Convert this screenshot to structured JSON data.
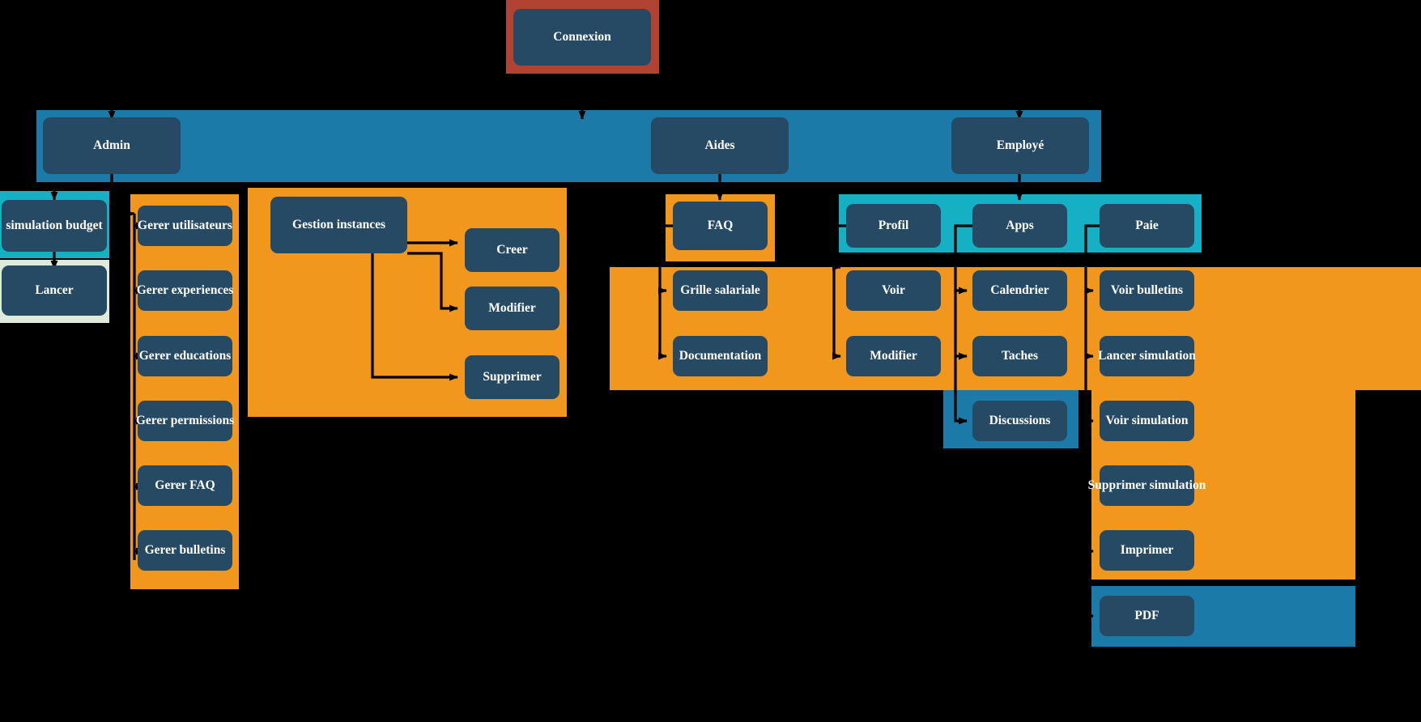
{
  "diagram": {
    "title": "Connexion",
    "type": "hierarchy-flowchart",
    "colors": {
      "node_fill": "#264a63",
      "node_text": "#ffffff",
      "root_band": "#b24232",
      "role_band": "#1b7aa8",
      "orange_band": "#f2971e",
      "cyan_band": "#16b0c4",
      "mint_band": "#dfeada",
      "blue_band": "#1b7aa8",
      "connector": "#000000",
      "background": "#000000"
    },
    "root": {
      "label": "Connexion"
    },
    "roles": [
      {
        "label": "Admin"
      },
      {
        "label": "Aides"
      },
      {
        "label": "Employé"
      }
    ],
    "admin_budget": [
      {
        "label": "simulation budget"
      },
      {
        "label": "Lancer"
      }
    ],
    "admin_manage": [
      {
        "label": "Gerer utilisateurs"
      },
      {
        "label": "Gerer experiences"
      },
      {
        "label": "Gerer educations"
      },
      {
        "label": "Gerer permissions"
      },
      {
        "label": "Gerer FAQ"
      },
      {
        "label": "Gerer bulletins"
      }
    ],
    "instances": {
      "parent": "Gestion instances",
      "children": [
        {
          "label": "Creer"
        },
        {
          "label": "Modifier"
        },
        {
          "label": "Supprimer"
        }
      ]
    },
    "aides": {
      "parent": "FAQ",
      "children": [
        {
          "label": "Grille salariale"
        },
        {
          "label": "Documentation"
        }
      ]
    },
    "employe": {
      "profil": {
        "parent": "Profil",
        "children": [
          {
            "label": "Voir"
          },
          {
            "label": "Modifier"
          }
        ]
      },
      "apps": {
        "parent": "Apps",
        "children": [
          {
            "label": "Calendrier"
          },
          {
            "label": "Taches"
          },
          {
            "label": "Discussions"
          }
        ]
      },
      "paie": {
        "parent": "Paie",
        "children": [
          {
            "label": "Voir bulletins"
          },
          {
            "label": "Lancer simulation"
          },
          {
            "label": "Voir simulation"
          },
          {
            "label": "Supprimer simulation"
          },
          {
            "label": "Imprimer"
          },
          {
            "label": "PDF"
          }
        ]
      }
    }
  }
}
